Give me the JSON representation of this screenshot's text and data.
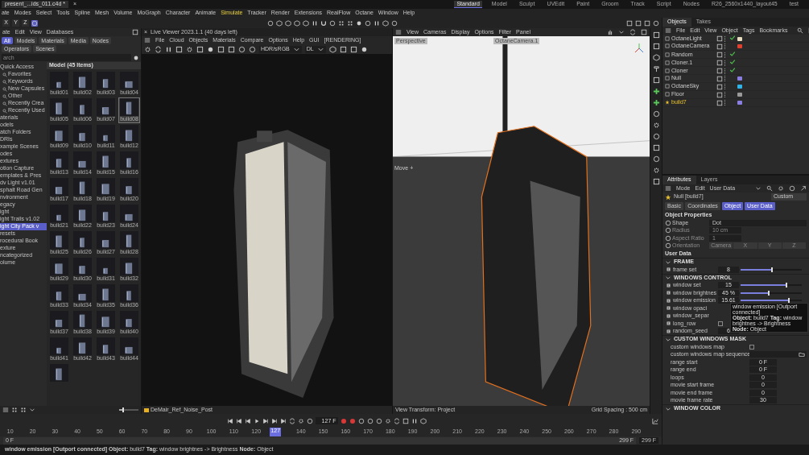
{
  "titlebar": {
    "document_tab": "present_...ids_011.c4d *",
    "close": "×",
    "layouts": [
      {
        "label": "Standard",
        "selected": true
      },
      {
        "label": "Model",
        "selected": false
      },
      {
        "label": "Sculpt",
        "selected": false
      },
      {
        "label": "UVEdit",
        "selected": false
      },
      {
        "label": "Paint",
        "selected": false
      },
      {
        "label": "Groom",
        "selected": false
      },
      {
        "label": "Track",
        "selected": false
      },
      {
        "label": "Script",
        "selected": false
      },
      {
        "label": "Nodes",
        "selected": false
      },
      {
        "label": "R26_2560x1440_layout45",
        "selected": false
      },
      {
        "label": "test",
        "selected": false
      }
    ]
  },
  "menu": [
    {
      "label": "ate",
      "highlighted": false
    },
    {
      "label": "Modes",
      "highlighted": false
    },
    {
      "label": "Select",
      "highlighted": false
    },
    {
      "label": "Tools",
      "highlighted": false
    },
    {
      "label": "Spline",
      "highlighted": false
    },
    {
      "label": "Mesh",
      "highlighted": false
    },
    {
      "label": "Volume",
      "highlighted": false
    },
    {
      "label": "MoGraph",
      "highlighted": false
    },
    {
      "label": "Character",
      "highlighted": false
    },
    {
      "label": "Animate",
      "highlighted": false
    },
    {
      "label": "Simulate",
      "highlighted": true
    },
    {
      "label": "Tracker",
      "highlighted": false
    },
    {
      "label": "Render",
      "highlighted": false
    },
    {
      "label": "Extensions",
      "highlighted": false
    },
    {
      "label": "RealFlow",
      "highlighted": false
    },
    {
      "label": "Octane",
      "highlighted": false
    },
    {
      "label": "Window",
      "highlighted": false
    },
    {
      "label": "Help",
      "highlighted": false
    }
  ],
  "axis_toggles": [
    "X",
    "Y",
    "Z"
  ],
  "asset_browser": {
    "menu": [
      "ate",
      "Edit",
      "View",
      "Databases"
    ],
    "filters": [
      {
        "label": "All",
        "selected": true
      },
      {
        "label": "Models",
        "selected": false
      },
      {
        "label": "Materials",
        "selected": false
      },
      {
        "label": "Media",
        "selected": false
      },
      {
        "label": "Nodes",
        "selected": false
      },
      {
        "label": "Operators",
        "selected": false
      },
      {
        "label": "Scenes",
        "selected": false
      }
    ],
    "search": {
      "placeholder": "arch"
    },
    "tree": [
      {
        "label": "Quick Access",
        "selected": false,
        "children": [
          {
            "label": "Favorites",
            "selected": false
          },
          {
            "label": "Keywords",
            "selected": false
          },
          {
            "label": "New Capsules",
            "selected": false
          },
          {
            "label": "Other",
            "selected": false
          },
          {
            "label": "Recently Crea",
            "selected": false
          },
          {
            "label": "Recently Used",
            "selected": false
          }
        ]
      },
      {
        "label": "aterials",
        "selected": false
      },
      {
        "label": "odels",
        "selected": false
      },
      {
        "label": "atch Folders",
        "selected": false
      },
      {
        "label": "DRIs",
        "selected": false
      },
      {
        "label": "xample Scenes",
        "selected": false
      },
      {
        "label": "odes",
        "selected": false
      },
      {
        "label": "extures",
        "selected": false
      },
      {
        "label": "otion Capture",
        "selected": false
      },
      {
        "label": "emplates & Pres",
        "selected": false
      },
      {
        "label": "dv Light v1.01",
        "selected": false
      },
      {
        "label": "sphalt Road Gen",
        "selected": false
      },
      {
        "label": "nvironment",
        "selected": false
      },
      {
        "label": "egacy",
        "selected": false
      },
      {
        "label": "ight",
        "selected": false
      },
      {
        "label": "ight Trails v1.02",
        "selected": false
      },
      {
        "label": "ight City Pack v",
        "selected": true
      },
      {
        "label": "resets",
        "selected": false
      },
      {
        "label": "rocedural Book",
        "selected": false
      },
      {
        "label": "exture",
        "selected": false
      },
      {
        "label": "ncategorized",
        "selected": false
      },
      {
        "label": "olume",
        "selected": false
      }
    ],
    "section_title": "Model (45 Items)",
    "size_slider": {
      "level": 0.15
    },
    "items": [
      {
        "label": "build01",
        "selected": false
      },
      {
        "label": "build02",
        "selected": false
      },
      {
        "label": "build03",
        "selected": false
      },
      {
        "label": "build04",
        "selected": false
      },
      {
        "label": "build05",
        "selected": false
      },
      {
        "label": "build06",
        "selected": false
      },
      {
        "label": "build07",
        "selected": false
      },
      {
        "label": "build08",
        "selected": true
      },
      {
        "label": "build09",
        "selected": false
      },
      {
        "label": "build10",
        "selected": false
      },
      {
        "label": "build11",
        "selected": false
      },
      {
        "label": "build12",
        "selected": false
      },
      {
        "label": "build13",
        "selected": false
      },
      {
        "label": "build14",
        "selected": false
      },
      {
        "label": "build15",
        "selected": false
      },
      {
        "label": "build16",
        "selected": false
      },
      {
        "label": "build17",
        "selected": false
      },
      {
        "label": "build18",
        "selected": false
      },
      {
        "label": "build19",
        "selected": false
      },
      {
        "label": "build20",
        "selected": false
      },
      {
        "label": "build21",
        "selected": false
      },
      {
        "label": "build22",
        "selected": false
      },
      {
        "label": "build23",
        "selected": false
      },
      {
        "label": "build24",
        "selected": false
      },
      {
        "label": "build25",
        "selected": false
      },
      {
        "label": "build26",
        "selected": false
      },
      {
        "label": "build27",
        "selected": false
      },
      {
        "label": "build28",
        "selected": false
      },
      {
        "label": "build29",
        "selected": false
      },
      {
        "label": "build30",
        "selected": false
      },
      {
        "label": "build31",
        "selected": false
      },
      {
        "label": "build32",
        "selected": false
      },
      {
        "label": "build33",
        "selected": false
      },
      {
        "label": "build34",
        "selected": false
      },
      {
        "label": "build35",
        "selected": false
      },
      {
        "label": "build36",
        "selected": false
      },
      {
        "label": "build37",
        "selected": false
      },
      {
        "label": "build38",
        "selected": false
      },
      {
        "label": "build39",
        "selected": false
      },
      {
        "label": "build40",
        "selected": false
      },
      {
        "label": "build41",
        "selected": false
      },
      {
        "label": "build42",
        "selected": false
      },
      {
        "label": "build43",
        "selected": false
      },
      {
        "label": "build44",
        "selected": false
      },
      {
        "selected": false
      }
    ]
  },
  "live_viewer": {
    "title": "Live Viewer 2023.1.1 (40 days left)",
    "close": "×",
    "menu": [
      "File",
      "Cloud",
      "Objects",
      "Materials",
      "Compare",
      "Options",
      "Help",
      "GUI",
      "[RENDERING]"
    ],
    "color_space": "HDR/sRGB",
    "kernel": "DL",
    "material_label": "DeMair_Ref_Noise_Post"
  },
  "viewport": {
    "menu": [
      "View",
      "Cameras",
      "Display",
      "Options",
      "Filter",
      "Panel"
    ],
    "view_name": "Perspective",
    "camera": "OctaneCamera.1",
    "tool": "Move",
    "tool_icon": "+",
    "view_transform": "View Transform: Project",
    "grid_spacing": "Grid Spacing : 500 cm"
  },
  "objects_panel": {
    "tabs": [
      {
        "label": "Objects",
        "selected": true
      },
      {
        "label": "Takes",
        "selected": false
      }
    ],
    "menu": [
      "File",
      "Edit",
      "View",
      "Object",
      "Tags",
      "Bookmarks"
    ],
    "objects": [
      {
        "name": "OctaneLight",
        "selected": false,
        "check": true,
        "color": "#e8dcc0"
      },
      {
        "name": "OctaneCamera",
        "selected": false,
        "check": false,
        "color": "#e04030"
      },
      {
        "name": "Random",
        "selected": false,
        "check": true
      },
      {
        "name": "Cloner.1",
        "selected": false,
        "check": true
      },
      {
        "name": "Cloner",
        "selected": false,
        "check": true
      },
      {
        "name": "Null",
        "selected": false,
        "check": false,
        "color": "#8a7ee0"
      },
      {
        "name": "OctaneSky",
        "selected": false,
        "check": false,
        "color": "#30b4e8"
      },
      {
        "name": "Floor",
        "selected": false,
        "check": false,
        "color": "#9a9a9a"
      },
      {
        "name": "build7",
        "selected": true,
        "check": false,
        "color": "#8a7ee0"
      }
    ]
  },
  "attributes": {
    "tabs": [
      {
        "label": "Attributes",
        "selected": true
      },
      {
        "label": "Layers",
        "selected": false
      }
    ],
    "menu": [
      "Mode",
      "Edit",
      "User Data"
    ],
    "object": "Null [build7]",
    "preset": "Custom",
    "pages": [
      {
        "label": "Basic",
        "selected": false
      },
      {
        "label": "Coordinates",
        "selected": false
      },
      {
        "label": "Object",
        "selected": true
      },
      {
        "label": "User Data",
        "selected": true
      }
    ],
    "object_properties": {
      "title": "Object Properties",
      "rows": [
        {
          "kind": "dropdown",
          "label": "Shape",
          "value": "Dot",
          "disabled": false
        },
        {
          "kind": "value",
          "label": "Radius",
          "value": "10 cm",
          "disabled": true
        },
        {
          "kind": "value",
          "label": "Aspect Ratio",
          "value": "1",
          "disabled": true
        },
        {
          "kind": "segments",
          "label": "Orientation",
          "options": [
            "Camera",
            "X",
            "Y",
            "Z"
          ],
          "disabled": true
        }
      ]
    },
    "user_data_title": "User Data",
    "groups": [
      {
        "title": "FRAME",
        "row_icons": true,
        "rows": [
          {
            "kind": "slider",
            "label": "frame set",
            "value": "8",
            "level": 0.5
          }
        ]
      },
      {
        "title": "WINDOWS CONTROL",
        "row_icons": true,
        "rows": [
          {
            "kind": "slider",
            "label": "window set",
            "value": "15",
            "level": 0.74
          },
          {
            "kind": "slider",
            "label": "window brightnes",
            "value": "45 %",
            "level": 0.45
          },
          {
            "kind": "slider",
            "label": "window emission",
            "value": "15.61",
            "level": 0.78,
            "tooltip": {
              "title": "window emission [Outport connected]",
              "detail": "**Object:** build7 **Tag:** window brightnes -> Brightness **Node:** Object"
            }
          },
          {
            "kind": "label",
            "label": "window opaci"
          },
          {
            "kind": "label",
            "label": "window_separ"
          },
          {
            "kind": "checkbox",
            "label": "long_row",
            "checked": false
          },
          {
            "kind": "value",
            "label": "random_seed",
            "value": "6"
          }
        ]
      },
      {
        "title": "CUSTOM WINDOWS MASK",
        "row_icons": false,
        "rows": [
          {
            "kind": "checkbox",
            "label": "custom windows map",
            "checked": false
          },
          {
            "kind": "file",
            "label": "custom windows map sequence"
          },
          {
            "kind": "value",
            "label": "range start",
            "value": "0 F"
          },
          {
            "kind": "value",
            "label": "range end",
            "value": "0 F"
          },
          {
            "kind": "value",
            "label": "loops",
            "value": "0"
          },
          {
            "kind": "value",
            "label": "movie start frame",
            "value": "0"
          },
          {
            "kind": "value",
            "label": "movie end frame",
            "value": "0"
          },
          {
            "kind": "value",
            "label": "movie frame rate",
            "value": "30"
          }
        ]
      },
      {
        "title": "WINDOW COLOR"
      }
    ]
  },
  "timeline": {
    "frame": "127 F",
    "ruler": [
      "10",
      "20",
      "30",
      "40",
      "50",
      "60",
      "70",
      "80",
      "90",
      "100",
      "110",
      "120",
      "140",
      "150",
      "160",
      "170",
      "180",
      "190",
      "200",
      "210",
      "220",
      "230",
      "240",
      "250",
      "260",
      "270",
      "280",
      "290"
    ],
    "playhead": "127",
    "level": 0.423,
    "range_start": "0 F",
    "range_end": "299 F",
    "max_frame": "299 F"
  },
  "status_bar": "**window emission [Outport connected] Object:** build7 **Tag:** window brightnes -> Brightness **Node:** Object"
}
